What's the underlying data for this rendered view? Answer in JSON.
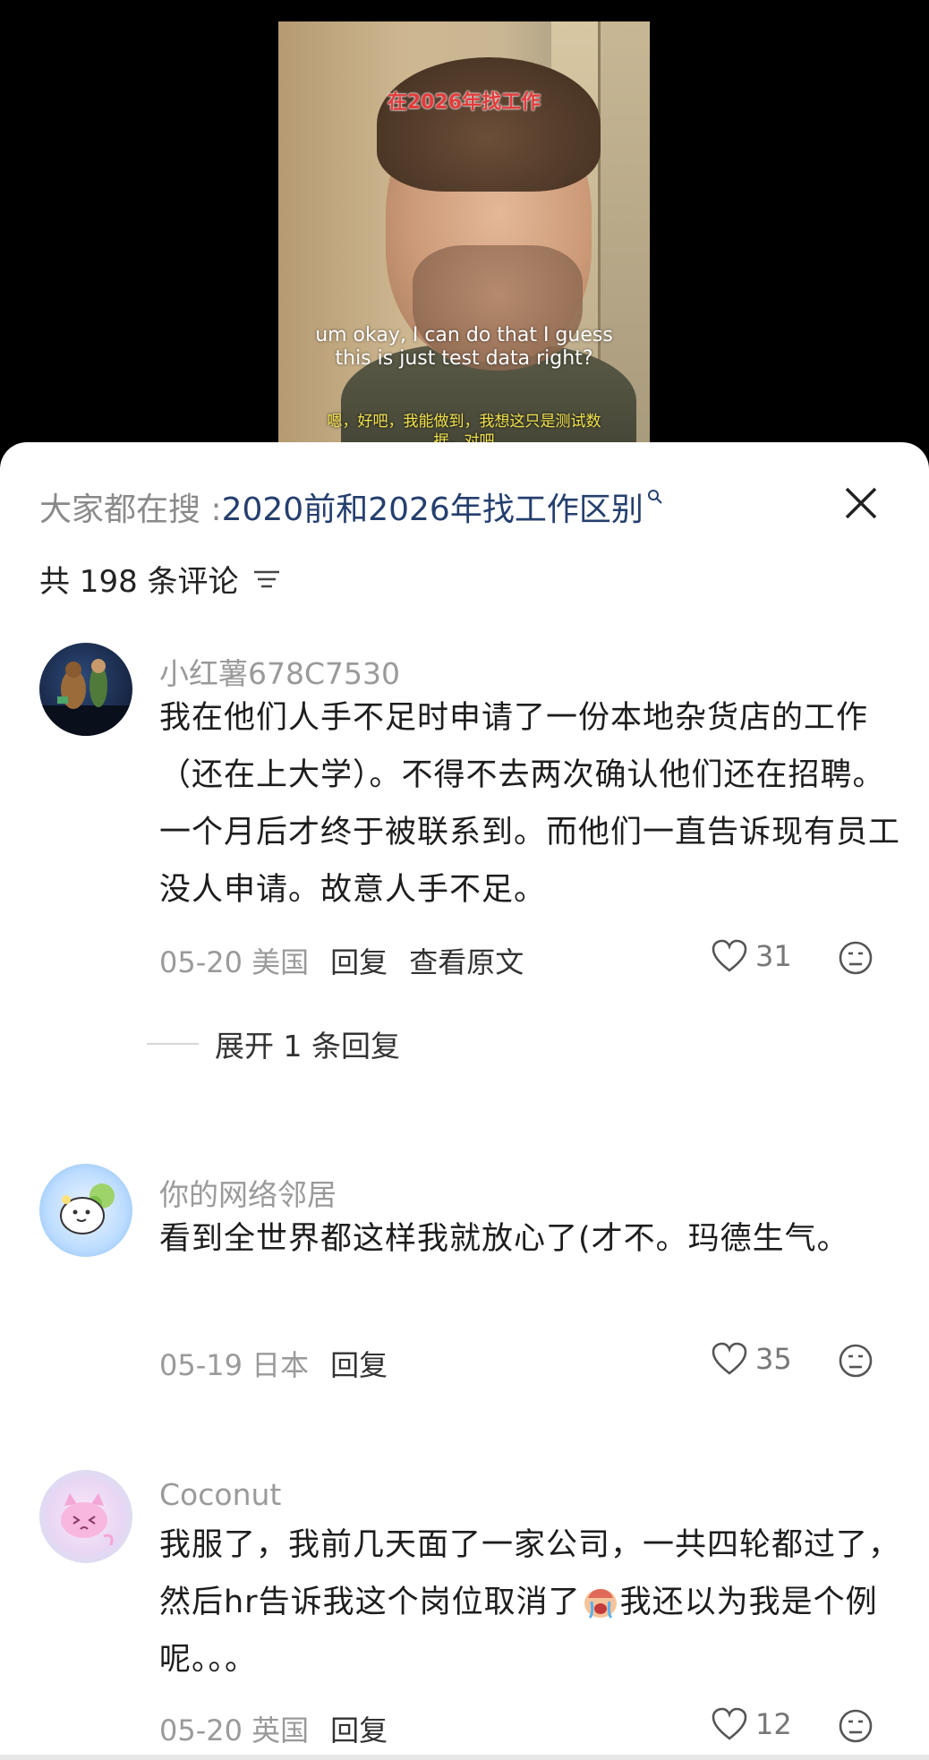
{
  "video": {
    "title_overlay": "在2026年找工作",
    "subtitle_en": "um okay, I can do that I guess this is just test data right?",
    "subtitle_cn": "嗯，好吧，我能做到，我想这只是测试数据，对吧"
  },
  "search": {
    "prefix": "大家都在搜 :",
    "term": "2020前和2026年找工作区别"
  },
  "comments_header": {
    "count_label": "共 198 条评论"
  },
  "comments": [
    {
      "username": "小红薯678C7530",
      "text": "我在他们人手不足时申请了一份本地杂货店的工作（还在上大学）。不得不去两次确认他们还在招聘。一个月后才终于被联系到。而他们一直告诉现有员工没人申请。故意人手不足。",
      "date_location": "05-20 美国",
      "reply_label": "回复",
      "view_original_label": "查看原文",
      "likes": "31",
      "expand_replies_label": "展开 1 条回复"
    },
    {
      "username": "你的网络邻居",
      "text": "看到全世界都这样我就放心了(才不。玛德生气。",
      "date_location": "05-19 日本",
      "reply_label": "回复",
      "likes": "35"
    },
    {
      "username": "Coconut",
      "text_before_emoji": "我服了，我前几天面了一家公司，一共四轮都过了，然后hr告诉我这个岗位取消了",
      "text_after_emoji": "我还以为我是个例呢。。。",
      "date_location": "05-20 英国",
      "reply_label": "回复",
      "likes": "12"
    }
  ],
  "colors": {
    "search_term": "#253f6e",
    "muted_text": "#9a9a9a",
    "body_text": "#1d1d1d",
    "title_overlay": "#e33b3b",
    "subtitle_cn": "#f2e34c"
  }
}
